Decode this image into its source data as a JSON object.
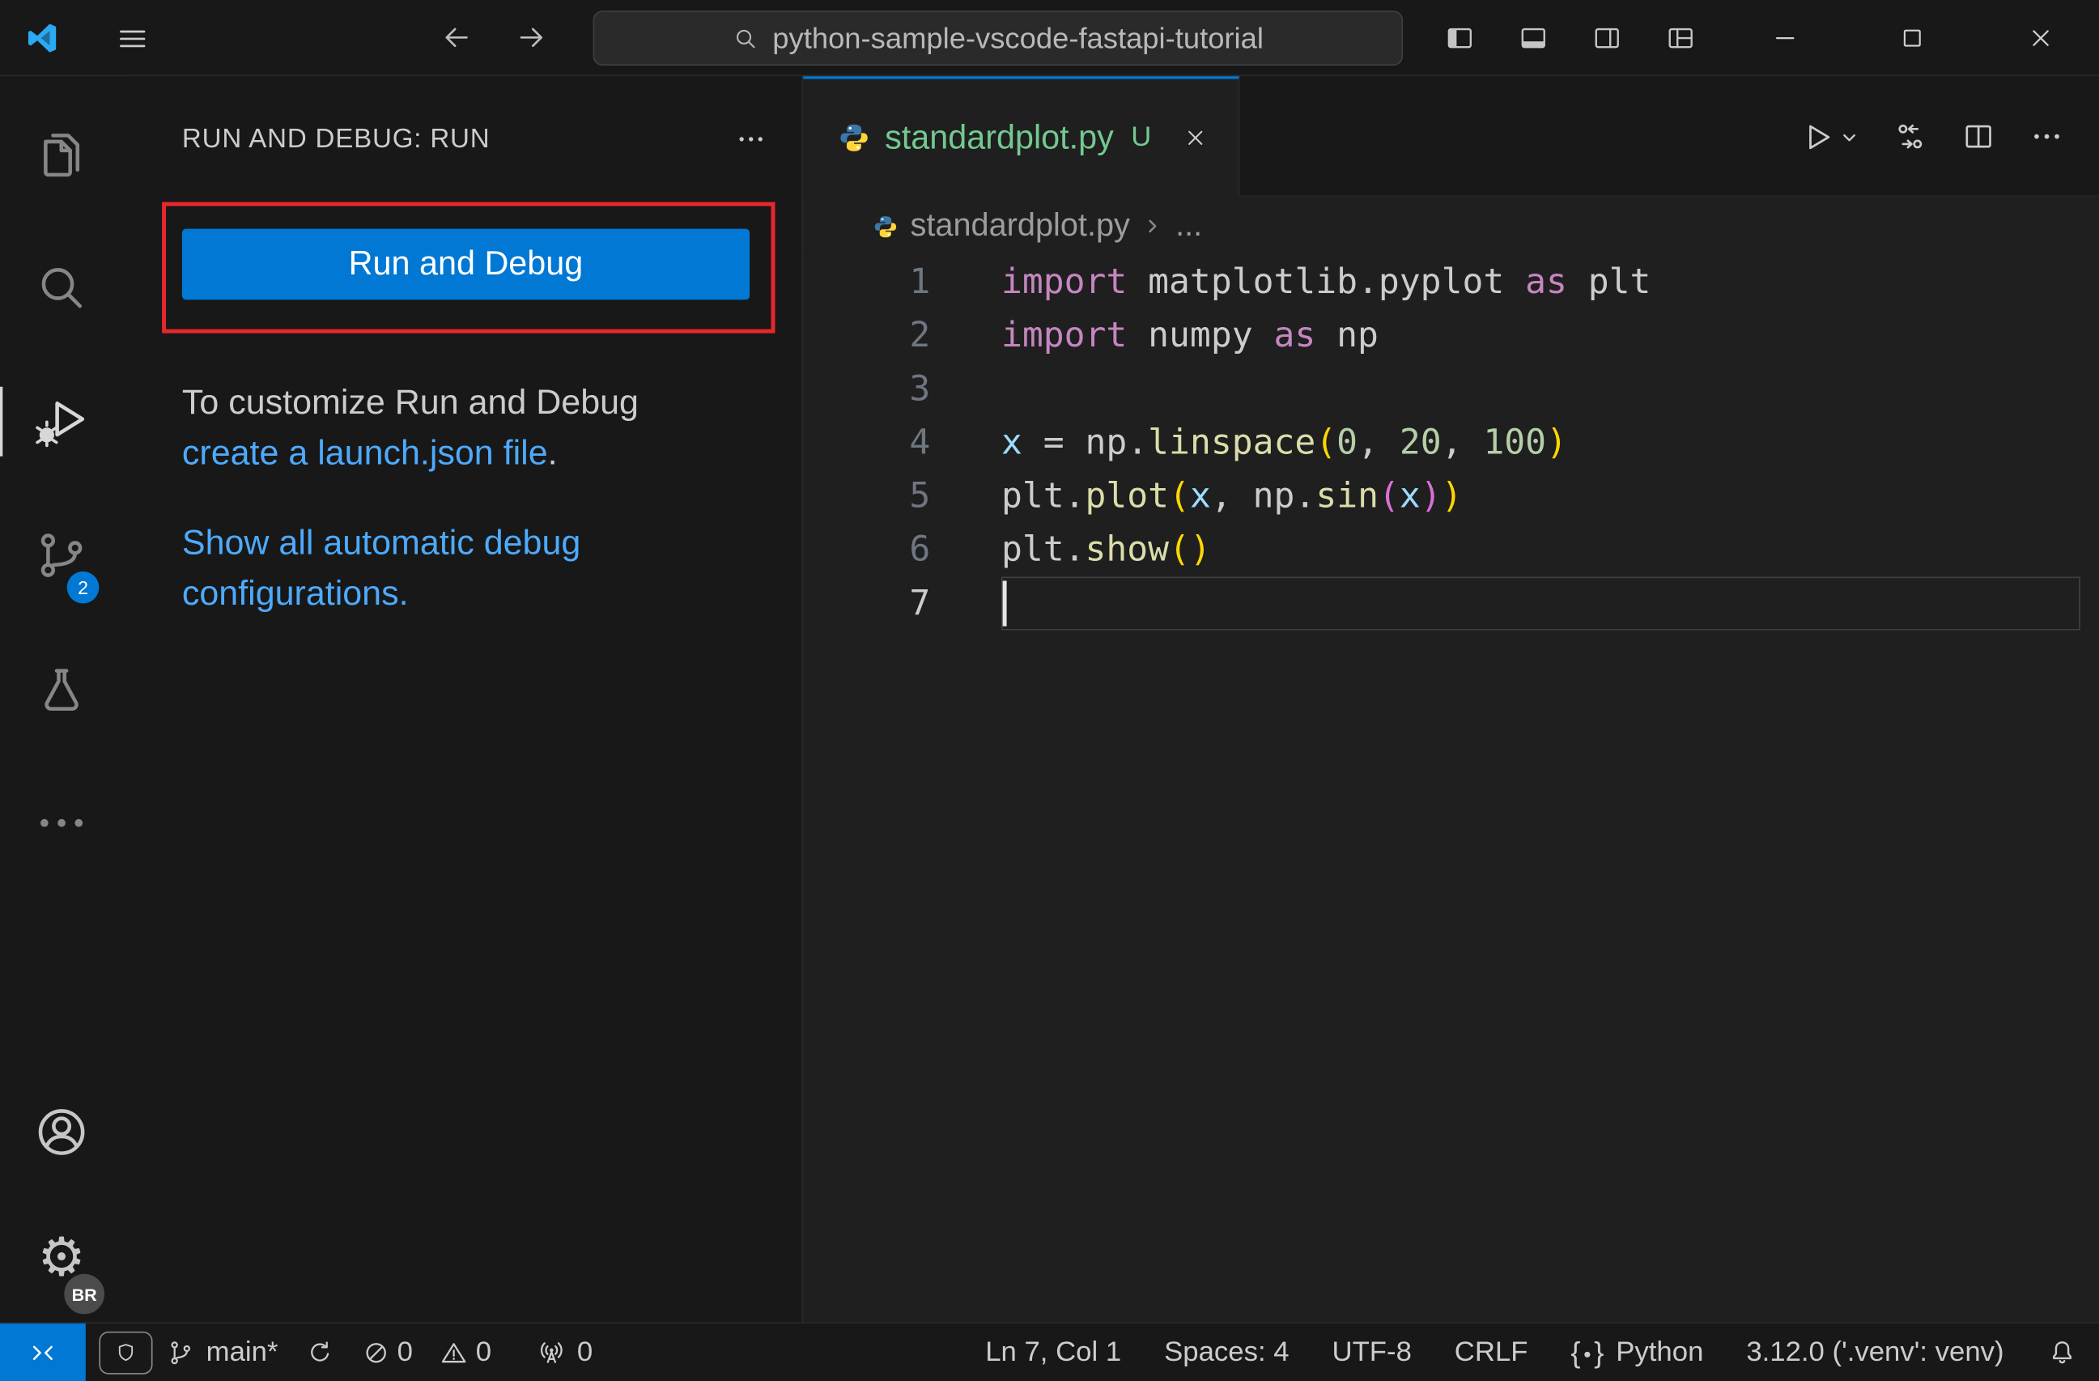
{
  "colors": {
    "accent": "#0078d4",
    "link": "#4daafc",
    "annotation": "#e8272c",
    "untracked": "#73c991",
    "py_blue": "#3b77a8",
    "py_yellow": "#ffd43b",
    "tok_kw": "#c586c0",
    "tok_pl": "#cccccc",
    "tok_var": "#9cdcfe",
    "tok_fn": "#dcdcaa",
    "tok_num": "#b5cea8",
    "tok_b1": "#ffd700",
    "tok_b2": "#da70d6"
  },
  "title_bar": {
    "search_value": "python-sample-vscode-fastapi-tutorial"
  },
  "activity_bar": {
    "scm_badge": "2",
    "profile_badge": "BR"
  },
  "sidebar": {
    "header": "RUN AND DEBUG: RUN",
    "run_button": "Run and Debug",
    "customize_line1": "To customize Run and Debug",
    "customize_link": "create a launch.json file",
    "customize_suffix": ".",
    "auto_config_link_line1": "Show all automatic debug",
    "auto_config_link_line2": "configurations."
  },
  "editor": {
    "tab": {
      "title": "standardplot.py",
      "git_badge": "U"
    },
    "breadcrumb": {
      "file": "standardplot.py",
      "ellipsis": "..."
    },
    "code": {
      "active_line": 7,
      "lines": [
        [
          [
            "kw",
            "import"
          ],
          [
            "pl",
            " matplotlib.pyplot "
          ],
          [
            "kw",
            "as"
          ],
          [
            "pl",
            " plt"
          ]
        ],
        [
          [
            "kw",
            "import"
          ],
          [
            "pl",
            " numpy "
          ],
          [
            "kw",
            "as"
          ],
          [
            "pl",
            " np"
          ]
        ],
        [],
        [
          [
            "var",
            "x"
          ],
          [
            "pl",
            " = np."
          ],
          [
            "fn",
            "linspace"
          ],
          [
            "b1",
            "("
          ],
          [
            "num",
            "0"
          ],
          [
            "pl",
            ", "
          ],
          [
            "num",
            "20"
          ],
          [
            "pl",
            ", "
          ],
          [
            "num",
            "100"
          ],
          [
            "b1",
            ")"
          ]
        ],
        [
          [
            "pl",
            "plt."
          ],
          [
            "fn",
            "plot"
          ],
          [
            "b1",
            "("
          ],
          [
            "var",
            "x"
          ],
          [
            "pl",
            ", np."
          ],
          [
            "fn",
            "sin"
          ],
          [
            "b2",
            "("
          ],
          [
            "var",
            "x"
          ],
          [
            "b2",
            ")"
          ],
          [
            "b1",
            ")"
          ]
        ],
        [
          [
            "pl",
            "plt."
          ],
          [
            "fn",
            "show"
          ],
          [
            "b1",
            "("
          ],
          [
            "b1",
            ")"
          ]
        ],
        []
      ]
    }
  },
  "status_bar": {
    "branch": "main*",
    "errors": "0",
    "warnings": "0",
    "ports": "0",
    "cursor_position": "Ln 7, Col 1",
    "indentation": "Spaces: 4",
    "encoding": "UTF-8",
    "eol": "CRLF",
    "language": "Python",
    "interpreter": "3.12.0 ('.venv': venv)"
  }
}
